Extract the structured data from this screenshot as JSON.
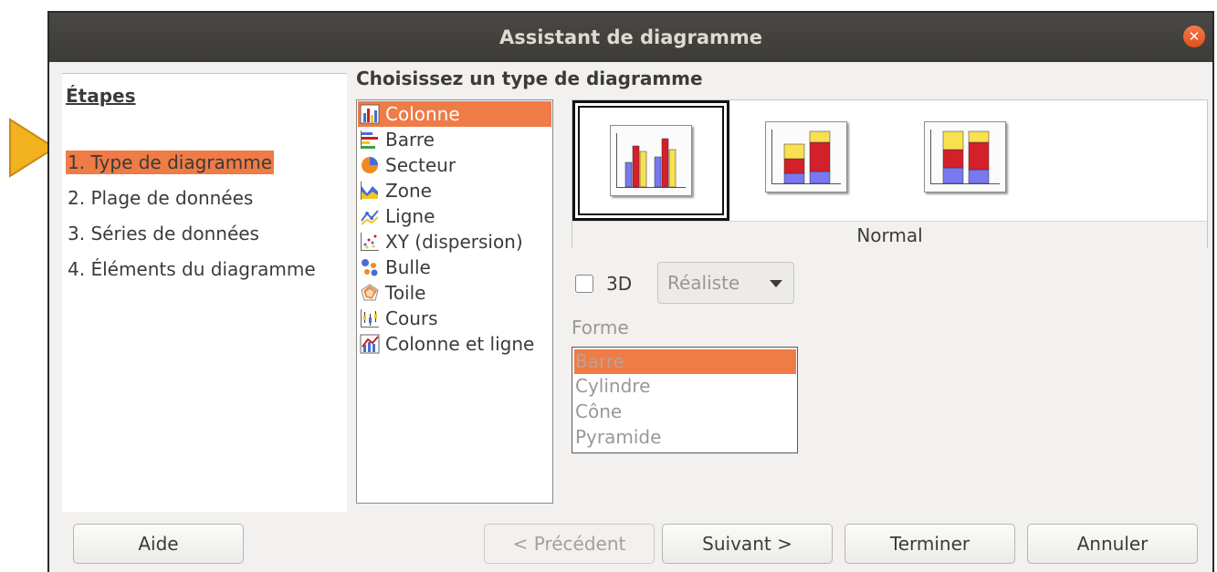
{
  "window": {
    "title": "Assistant de diagramme",
    "close": "✕"
  },
  "steps": {
    "heading": "Étapes",
    "items": [
      {
        "label": "1. Type de diagramme",
        "active": true
      },
      {
        "label": "2. Plage de données",
        "active": false
      },
      {
        "label": "3. Séries de données",
        "active": false
      },
      {
        "label": "4. Éléments du diagramme",
        "active": false
      }
    ]
  },
  "chart_type": {
    "heading": "Choisissez un type de diagramme",
    "types": [
      {
        "label": "Colonne",
        "icon": "column-chart-icon",
        "selected": true
      },
      {
        "label": "Barre",
        "icon": "bar-chart-icon",
        "selected": false
      },
      {
        "label": "Secteur",
        "icon": "pie-chart-icon",
        "selected": false
      },
      {
        "label": "Zone",
        "icon": "area-chart-icon",
        "selected": false
      },
      {
        "label": "Ligne",
        "icon": "line-chart-icon",
        "selected": false
      },
      {
        "label": "XY (dispersion)",
        "icon": "scatter-chart-icon",
        "selected": false
      },
      {
        "label": "Bulle",
        "icon": "bubble-chart-icon",
        "selected": false
      },
      {
        "label": "Toile",
        "icon": "net-chart-icon",
        "selected": false
      },
      {
        "label": "Cours",
        "icon": "stock-chart-icon",
        "selected": false
      },
      {
        "label": "Colonne et ligne",
        "icon": "column-line-chart-icon",
        "selected": false
      }
    ],
    "variant_caption": "Normal",
    "variants": [
      "normal",
      "stacked",
      "percent-stacked"
    ]
  },
  "options": {
    "three_d_label": "3D",
    "three_d_checked": false,
    "look_value": "Réaliste",
    "shape_label": "Forme",
    "shapes": [
      {
        "label": "Barre",
        "selected": true
      },
      {
        "label": "Cylindre",
        "selected": false
      },
      {
        "label": "Cône",
        "selected": false
      },
      {
        "label": "Pyramide",
        "selected": false
      }
    ]
  },
  "buttons": {
    "help": "Aide",
    "previous": "< Précédent",
    "next": "Suivant >",
    "finish": "Terminer",
    "cancel": "Annuler"
  },
  "colors": {
    "accent": "#ef7b46",
    "titlebar": "#3c3b37",
    "pointer": "#f2b21f"
  }
}
